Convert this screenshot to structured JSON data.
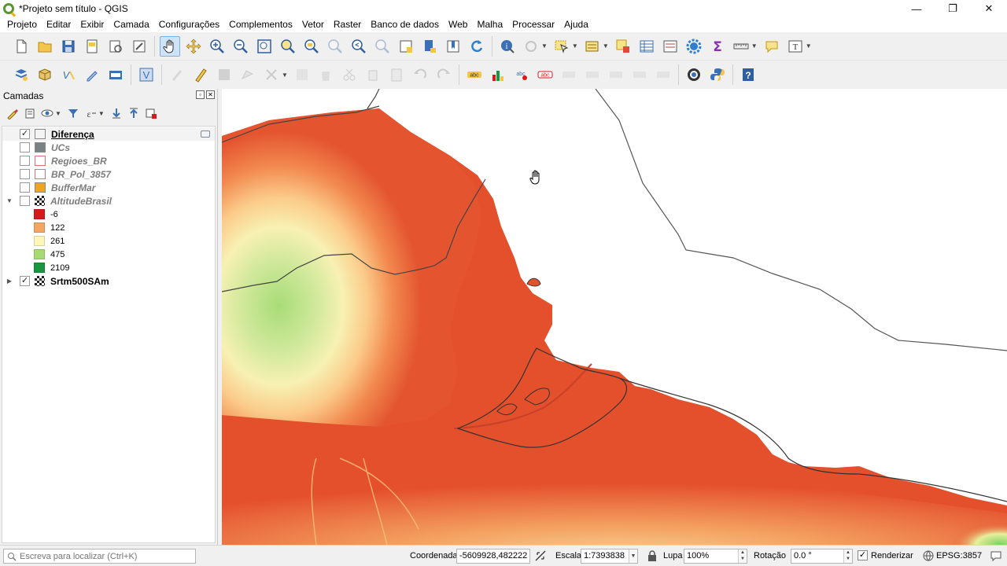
{
  "window": {
    "title": "*Projeto sem título - QGIS",
    "minimize": "—",
    "restore": "❐",
    "close": "✕"
  },
  "menu": [
    "Projeto",
    "Editar",
    "Exibir",
    "Camada",
    "Configurações",
    "Complementos",
    "Vetor",
    "Raster",
    "Banco de dados",
    "Web",
    "Malha",
    "Processar",
    "Ajuda"
  ],
  "layers_panel": {
    "title": "Camadas",
    "layers": [
      {
        "name": "Diferença",
        "checked": true,
        "symbol_color": "#f4f4f4",
        "style": "on-under"
      },
      {
        "name": "UCs",
        "checked": false,
        "symbol_color": "#7b8285",
        "style": "off"
      },
      {
        "name": "Regioes_BR",
        "checked": false,
        "symbol_color": "#ffffff",
        "symbol_border": "#e07070",
        "style": "off"
      },
      {
        "name": "BR_Pol_3857",
        "checked": false,
        "symbol_color": "#ffffff",
        "symbol_border": "#e07070",
        "style": "off"
      },
      {
        "name": "BufferMar",
        "checked": false,
        "symbol_color": "#f2a421",
        "style": "off"
      },
      {
        "name": "AltitudeBrasil",
        "checked": false,
        "style": "off"
      },
      {
        "name": "Srtm500SAm",
        "checked": true,
        "style": "on"
      }
    ],
    "legend": [
      {
        "label": "-6",
        "color": "#d7191c"
      },
      {
        "label": "122",
        "color": "#f4a562"
      },
      {
        "label": "261",
        "color": "#fdf6b9"
      },
      {
        "label": "475",
        "color": "#a6db74"
      },
      {
        "label": "2109",
        "color": "#1a9641"
      }
    ]
  },
  "status": {
    "search_placeholder": "Escreva para localizar (Ctrl+K)",
    "coord_label": "Coordenada",
    "coord_value": "-5609928,482222",
    "scale_label": "Escala",
    "scale_value": "1:7393838",
    "magnifier_label": "Lupa",
    "magnifier_value": "100%",
    "rotation_label": "Rotação",
    "rotation_value": "0.0 °",
    "render_label": "Renderizar",
    "render_checked": "✓",
    "crs": "EPSG:3857"
  },
  "colors": {
    "accent": "#589632",
    "selection": "#cfe3f7"
  }
}
